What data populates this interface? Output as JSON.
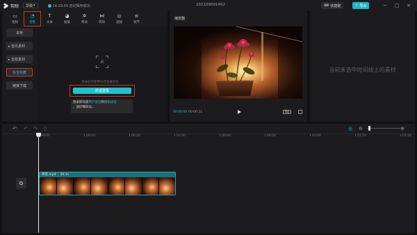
{
  "app": {
    "name": "剪映",
    "layout_label": "草稿",
    "save_status": "14:29:45 自动保存成功",
    "project_title": "202109091402",
    "shortcut_label": "快捷键",
    "export_label": "导出",
    "accent_color": "#22c4d0",
    "highlight_color": "#d9302c"
  },
  "toolbar": {
    "tools": [
      {
        "label": "视频",
        "icon": "video-icon"
      },
      {
        "label": "音频",
        "icon": "audio-icon",
        "active": true
      },
      {
        "label": "文本",
        "icon": "text-icon"
      },
      {
        "label": "贴纸",
        "icon": "sticker-icon"
      },
      {
        "label": "特效",
        "icon": "effects-icon"
      },
      {
        "label": "转场",
        "icon": "transition-icon"
      },
      {
        "label": "滤镜",
        "icon": "filter-icon"
      },
      {
        "label": "调节",
        "icon": "adjust-icon"
      }
    ]
  },
  "media_nav": {
    "items": [
      {
        "label": "本地"
      },
      {
        "label": "▸ 音乐素材"
      },
      {
        "label": "▸ 音效素材"
      },
      {
        "label": "抖音收藏",
        "active": true
      },
      {
        "label": "链接下载"
      }
    ]
  },
  "media": {
    "login_hint": "登录后可使用抖音收藏音乐",
    "login_button": "抖音登录",
    "agree_prefix": "登录即同意",
    "agree_link1": "用户协议",
    "agree_mid": "和",
    "agree_link2": "隐私协议",
    "agree_suffix": "，请仔细阅读。"
  },
  "player": {
    "title": "播放器",
    "time_current": "00:00:00",
    "time_total": "00:00:31",
    "ratio_label": "原始"
  },
  "properties": {
    "empty_text": "当前未选中时间线上的素材"
  },
  "timeline": {
    "ruler": [
      "00:00",
      "00:10",
      "00:20",
      "00:30",
      "00:40",
      "00:50",
      "01:00",
      "01:10",
      "01:20"
    ],
    "clip": {
      "name": "荷花.mp4",
      "duration": "30.1s",
      "thumbnail_count": 8
    }
  }
}
